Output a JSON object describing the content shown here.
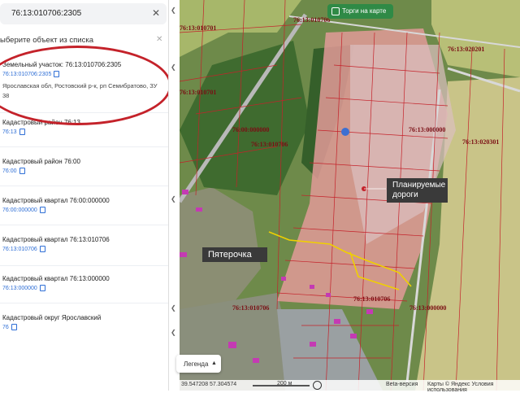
{
  "sidebar": {
    "search_value": "76:13:010706:2305",
    "choose_label": "ыберите объект из списка",
    "items": [
      {
        "title": "Земельный участок: 76:13:010706:2305",
        "sub": "76:13:010706:2305",
        "address": "Ярославская обл, Ростовский р-к, рп Семибратово, ЗУ 38"
      },
      {
        "title": "Кадастровый район 76:13",
        "sub": "76:13"
      },
      {
        "title": "Кадастровый район 76:00",
        "sub": "76:00"
      },
      {
        "title": "Кадастровый квартал 76:00:000000",
        "sub": "76:00:000000"
      },
      {
        "title": "Кадастровый квартал 76:13:010706",
        "sub": "76:13:010706"
      },
      {
        "title": "Кадастровый квартал 76:13:000000",
        "sub": "76:13:000000"
      },
      {
        "title": "Кадастровый округ Ярославский",
        "sub": "76"
      }
    ]
  },
  "map": {
    "torgi_button": "Торги на карте",
    "legend_button": "Легенда",
    "callout_pyaterochka": "Пятерочка",
    "callout_roads_line1": "Планируемые",
    "callout_roads_line2": "дороги",
    "parcel_labels": [
      "76:13:010701",
      "76:13:010706",
      "76:13:020201",
      "76:13:010701",
      "76:00:000000",
      "76:13:000000",
      "76:13:010706",
      "76:13:020301",
      "76:13:010706",
      "76:13:010706",
      "76:13:000000"
    ],
    "coords": "39.547208  57.304574",
    "scale": "200 м",
    "beta": "Beta-версия",
    "copyright": "Карты © Яндекс  Условия использования"
  },
  "colors": {
    "highlight": "#c4222a",
    "parcel": "#e0555d",
    "road_plan": "#f0d000",
    "torgi": "#2f8a46"
  }
}
